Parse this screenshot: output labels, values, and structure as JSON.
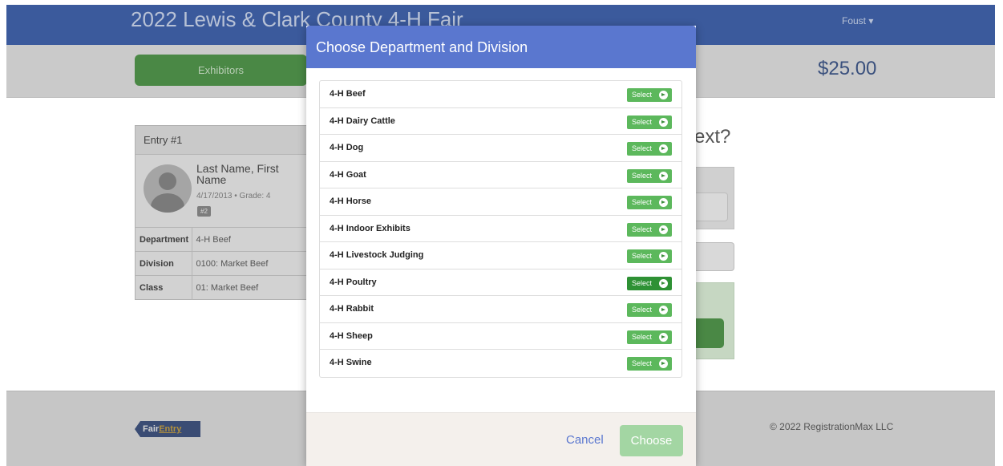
{
  "header": {
    "fair_title": "2022 Lewis & Clark County 4-H Fair",
    "user": "Foust ▾"
  },
  "subbar": {
    "exhibitors_tab": "Exhibitors",
    "total": "$25.00"
  },
  "entry": {
    "title": "Entry #1",
    "name": "Last Name, First Name",
    "meta": "4/17/2013 • Grade: 4",
    "badge": "#2",
    "rows": [
      {
        "key": "Department",
        "value": "4-H Beef"
      },
      {
        "key": "Division",
        "value": "0100: Market Beef"
      },
      {
        "key": "Class",
        "value": "01: Market Beef"
      }
    ]
  },
  "right_panel": {
    "question_fragment": "ext?"
  },
  "footer": {
    "logo_fair": "Fair",
    "logo_entry": "Entry",
    "copyright": "© 2022 RegistrationMax LLC"
  },
  "modal": {
    "title": "Choose Department and Division",
    "select_label": "Select",
    "departments": [
      "4-H Beef",
      "4-H Dairy Cattle",
      "4-H Dog",
      "4-H Goat",
      "4-H Horse",
      "4-H Indoor Exhibits",
      "4-H Livestock Judging",
      "4-H Poultry",
      "4-H Rabbit",
      "4-H Sheep",
      "4-H Swine"
    ],
    "cancel_label": "Cancel",
    "choose_label": "Choose"
  },
  "colors": {
    "header_blue": "#3b5a9c",
    "modal_blue": "#5a77cf",
    "select_green": "#5cb85c",
    "choose_green": "#a3d6a3"
  }
}
